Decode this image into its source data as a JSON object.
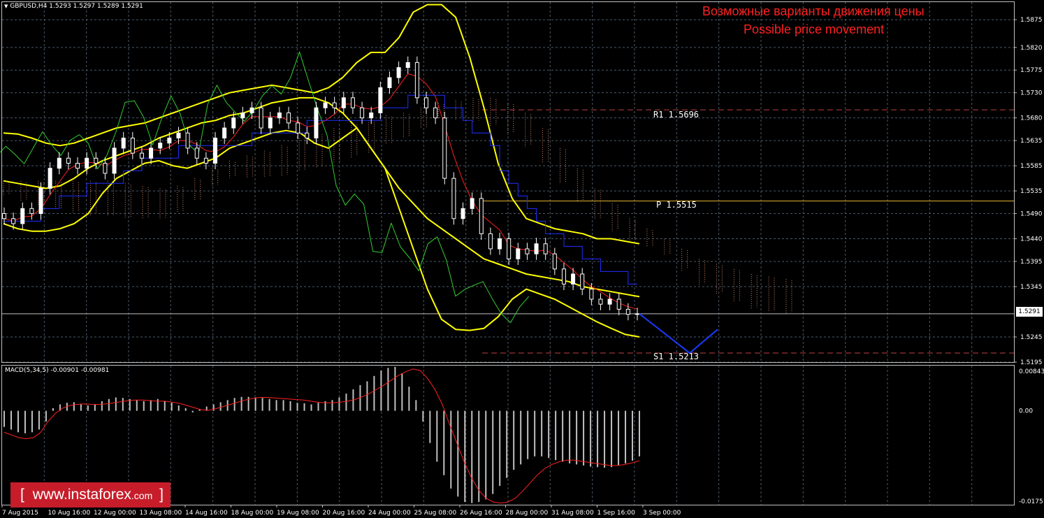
{
  "window": {
    "symbol_line": "GBPUSD,H4  1.5293 1.5297 1.5289 1.5291"
  },
  "annotation": {
    "title_ru": "Возможные варианты движения цены",
    "title_en": "Possible price movement"
  },
  "colors": {
    "background": "#000000",
    "grid": "#4a5a6a",
    "axis_text": "#ffffff",
    "bull_candle": "#ffffff",
    "bear_candle": "#ffffff",
    "bollinger": "#ffff00",
    "tenkan": "#ff2020",
    "kijun": "#2030ff",
    "chikou": "#33cc33",
    "cloud": "#d08a6a",
    "pivot_level": "#e0b030",
    "rs_level": "#c04040",
    "forecast": "#1a3aff",
    "macd_hist": "#c0c0c0",
    "macd_signal": "#ff2020",
    "title_text": "#ff2020",
    "brand_bg": "#c71d2a"
  },
  "chart_data": [
    {
      "type": "candlestick",
      "title": "GBPUSD,H4",
      "ohlc_current": {
        "open": 1.5293,
        "high": 1.5297,
        "low": 1.5289,
        "close": 1.5291
      },
      "current_price_label": "1.5291",
      "ylim": [
        1.5195,
        1.591
      ],
      "y_ticks": [
        "1.5875",
        "1.5820",
        "1.5775",
        "1.5730",
        "1.5680",
        "1.5635",
        "1.5585",
        "1.5535",
        "1.5490",
        "1.5440",
        "1.5395",
        "1.5345",
        "1.5245",
        "1.5195"
      ],
      "x_ticks": [
        "7 Aug 2015",
        "10 Aug 16:00",
        "12 Aug 00:00",
        "13 Aug 08:00",
        "14 Aug 16:00",
        "18 Aug 00:00",
        "19 Aug 08:00",
        "20 Aug 16:00",
        "24 Aug 00:00",
        "25 Aug 08:00",
        "26 Aug 16:00",
        "28 Aug 00:00",
        "31 Aug 08:00",
        "1 Sep 16:00",
        "3 Sep 00:00"
      ],
      "levels": [
        {
          "name": "R1",
          "value": 1.5696,
          "label": "R1 1.5696",
          "style": "dashed"
        },
        {
          "name": "P",
          "value": 1.5515,
          "label": "P 1.5515",
          "style": "solid"
        },
        {
          "name": "S1",
          "value": 1.5213,
          "label": "S1 1.5213",
          "style": "dashed"
        }
      ],
      "forecast_path": [
        1.5291,
        1.5213,
        1.526
      ],
      "close_series": [
        1.548,
        1.547,
        1.55,
        1.549,
        1.554,
        1.558,
        1.56,
        1.559,
        1.558,
        1.56,
        1.559,
        1.557,
        1.562,
        1.564,
        1.561,
        1.56,
        1.562,
        1.563,
        1.564,
        1.565,
        1.562,
        1.56,
        1.559,
        1.564,
        1.566,
        1.568,
        1.569,
        1.57,
        1.566,
        1.568,
        1.569,
        1.567,
        1.565,
        1.564,
        1.57,
        1.571,
        1.57,
        1.572,
        1.57,
        1.568,
        1.569,
        1.574,
        1.576,
        1.578,
        1.579,
        1.572,
        1.57,
        1.568,
        1.556,
        1.548,
        1.55,
        1.552,
        1.545,
        1.542,
        1.544,
        1.54,
        1.542,
        1.541,
        1.543,
        1.541,
        1.538,
        1.535,
        1.537,
        1.534,
        1.532,
        1.531,
        1.532,
        1.53,
        1.529,
        1.5291
      ],
      "series": [
        {
          "name": "Bollinger upper",
          "values": [
            1.565,
            1.5648,
            1.564,
            1.563,
            1.5625,
            1.563,
            1.564,
            1.565,
            1.566,
            1.5665,
            1.567,
            1.568,
            1.569,
            1.57,
            1.571,
            1.572,
            1.573,
            1.5735,
            1.574,
            1.5745,
            1.574,
            1.5735,
            1.573,
            1.574,
            1.576,
            1.579,
            1.581,
            1.581,
            1.584,
            1.589,
            1.5905,
            1.5905,
            1.588,
            1.58,
            1.57,
            1.559,
            1.552,
            1.548,
            1.547,
            1.546,
            1.5455,
            1.545,
            1.544,
            1.544,
            1.5435,
            1.543
          ]
        },
        {
          "name": "Bollinger middle",
          "values": [
            1.5555,
            1.555,
            1.5545,
            1.554,
            1.5545,
            1.556,
            1.558,
            1.5595,
            1.5605,
            1.5615,
            1.5625,
            1.564,
            1.565,
            1.566,
            1.567,
            1.5675,
            1.5685,
            1.569,
            1.57,
            1.571,
            1.5715,
            1.572,
            1.572,
            1.571,
            1.569,
            1.566,
            1.562,
            1.558,
            1.554,
            1.551,
            1.548,
            1.546,
            1.544,
            1.542,
            1.54,
            1.539,
            1.538,
            1.537,
            1.5365,
            1.536,
            1.5355,
            1.5345,
            1.534,
            1.5335,
            1.533,
            1.5325
          ]
        },
        {
          "name": "Bollinger lower",
          "values": [
            1.547,
            1.546,
            1.5455,
            1.5455,
            1.546,
            1.547,
            1.549,
            1.553,
            1.556,
            1.5575,
            1.559,
            1.5595,
            1.5585,
            1.558,
            1.559,
            1.56,
            1.562,
            1.563,
            1.564,
            1.565,
            1.5655,
            1.565,
            1.563,
            1.562,
            1.564,
            1.566,
            1.562,
            1.558,
            1.55,
            1.542,
            1.534,
            1.528,
            1.526,
            1.5258,
            1.5262,
            1.5285,
            1.532,
            1.534,
            1.533,
            1.532,
            1.5305,
            1.529,
            1.5275,
            1.5262,
            1.525,
            1.5245
          ]
        }
      ]
    },
    {
      "type": "bar",
      "title": "MACD(5,34,5) -0.00901 -0.00981",
      "ylim": [
        -0.01751,
        0.00843
      ],
      "y_ticks": [
        "0.00843",
        "0.00",
        "-0.01751"
      ],
      "zero_label": "0.00",
      "histogram": [
        -0.003,
        -0.0035,
        -0.004,
        -0.0042,
        -0.004,
        -0.0035,
        -0.002,
        0.0005,
        0.0012,
        0.0015,
        0.0016,
        0.0013,
        0.001,
        0.0012,
        0.0018,
        0.0022,
        0.0025,
        0.0024,
        0.0022,
        0.002,
        0.0018,
        0.002,
        0.0022,
        0.0018,
        0.0015,
        0.001,
        0.0005,
        -0.0003,
        0.0003,
        0.0008,
        0.0012,
        0.0016,
        0.002,
        0.0024,
        0.0026,
        0.0026,
        0.0025,
        0.0024,
        0.0022,
        0.002,
        0.002,
        0.0018,
        0.0015,
        0.0014,
        0.0012,
        0.0015,
        0.0018,
        0.002,
        0.0025,
        0.0032,
        0.004,
        0.0048,
        0.0055,
        0.0065,
        0.0075,
        0.008,
        0.0082,
        0.007,
        0.0045,
        0.002,
        -0.002,
        -0.006,
        -0.0095,
        -0.012,
        -0.0145,
        -0.016,
        -0.017,
        -0.0172,
        -0.017,
        -0.0165,
        -0.0155,
        -0.014,
        -0.0125,
        -0.011,
        -0.01,
        -0.009,
        -0.0085,
        -0.0085,
        -0.0088,
        -0.0092,
        -0.0095,
        -0.0098,
        -0.01,
        -0.0102,
        -0.0104,
        -0.0105,
        -0.0106,
        -0.0105,
        -0.0102,
        -0.0098,
        -0.0093,
        -0.0085
      ],
      "signal": [
        -0.004,
        -0.0045,
        -0.005,
        -0.0052,
        -0.005,
        -0.004,
        -0.002,
        -0.0005,
        0.0005,
        0.001,
        0.0012,
        0.0013,
        0.0012,
        0.0012,
        0.0013,
        0.0015,
        0.0017,
        0.0019,
        0.002,
        0.002,
        0.0019,
        0.0018,
        0.0018,
        0.0016,
        0.0014,
        0.001,
        0.0006,
        0.0002,
        0.0001,
        0.0004,
        0.0008,
        0.0012,
        0.0016,
        0.002,
        0.0023,
        0.0025,
        0.0025,
        0.0024,
        0.0023,
        0.0022,
        0.0021,
        0.002,
        0.0018,
        0.0016,
        0.0015,
        0.0015,
        0.0016,
        0.0018,
        0.0021,
        0.0026,
        0.0032,
        0.004,
        0.0048,
        0.0057,
        0.0066,
        0.0073,
        0.0078,
        0.0075,
        0.006,
        0.004,
        0.0012,
        -0.0025,
        -0.006,
        -0.0095,
        -0.0125,
        -0.0148,
        -0.0163,
        -0.017,
        -0.0172,
        -0.017,
        -0.0163,
        -0.015,
        -0.0135,
        -0.012,
        -0.0108,
        -0.01,
        -0.0095,
        -0.0092,
        -0.0092,
        -0.0094,
        -0.0096,
        -0.0098,
        -0.01,
        -0.0102,
        -0.0102,
        -0.01,
        -0.0097,
        -0.0093
      ]
    }
  ],
  "branding": {
    "open": "[",
    "text": "www.instaforex",
    "tld": ".com",
    "close": "]"
  }
}
